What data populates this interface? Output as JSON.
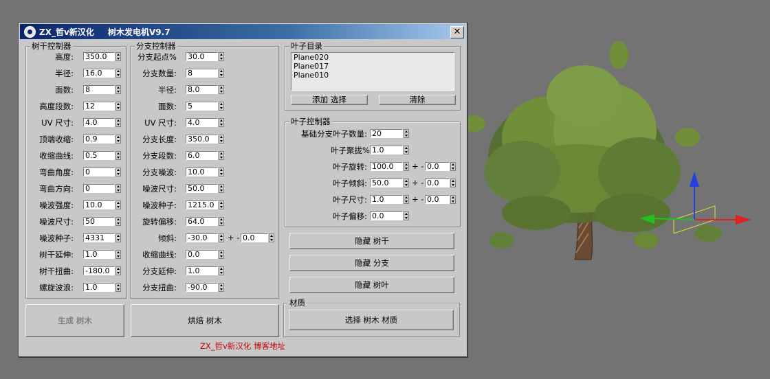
{
  "window": {
    "title_left": "ZX_哲v新汉化",
    "title_right": "树木发电机V9.7",
    "close_glyph": "✕"
  },
  "trunk": {
    "title": "树干控制器",
    "rows": [
      {
        "label": "高度:",
        "value": "350.0"
      },
      {
        "label": "半径:",
        "value": "16.0"
      },
      {
        "label": "面数:",
        "value": "8"
      },
      {
        "label": "高度段数:",
        "value": "12"
      },
      {
        "label": "UV 尺寸:",
        "value": "4.0"
      },
      {
        "label": "顶端收缩:",
        "value": "0.9"
      },
      {
        "label": "收缩曲线:",
        "value": "0.5"
      },
      {
        "label": "弯曲角度:",
        "value": "0"
      },
      {
        "label": "弯曲方向:",
        "value": "0"
      },
      {
        "label": "噪波强度:",
        "value": "10.0"
      },
      {
        "label": "噪波尺寸:",
        "value": "50"
      },
      {
        "label": "噪波种子:",
        "value": "4331"
      },
      {
        "label": "树干延伸:",
        "value": "1.0"
      },
      {
        "label": "树干扭曲:",
        "value": "-180.0"
      },
      {
        "label": "螺旋波浪:",
        "value": "1.0"
      }
    ]
  },
  "branch": {
    "title": "分支控制器",
    "rows": [
      {
        "label": "分支起点%",
        "value": "30.0"
      },
      {
        "label": "分支数量:",
        "value": "8"
      },
      {
        "label": "半径:",
        "value": "8.0"
      },
      {
        "label": "面数:",
        "value": "5"
      },
      {
        "label": "UV 尺寸:",
        "value": "4.0"
      },
      {
        "label": "分支长度:",
        "value": "350.0"
      },
      {
        "label": "分支段数:",
        "value": "6.0"
      },
      {
        "label": "分支噪波:",
        "value": "10.0"
      },
      {
        "label": "噪波尺寸:",
        "value": "50.0"
      },
      {
        "label": "噪波种子:",
        "value": "1215.0"
      },
      {
        "label": "旋转偏移:",
        "value": "64.0"
      },
      {
        "label": "倾斜:",
        "value": "-30.0"
      },
      {
        "label": "收缩曲线:",
        "value": "0.0"
      },
      {
        "label": "分支延伸:",
        "value": "1.0"
      },
      {
        "label": "分支扭曲:",
        "value": "-90.0"
      }
    ],
    "tilt_plusminus": "+ -",
    "tilt_variance": "0.0"
  },
  "leaf_list": {
    "title": "叶子目录",
    "items": [
      "Plane020",
      "Plane017",
      "Plane010"
    ],
    "add_label": "添加 选择",
    "clear_label": "清除"
  },
  "leaf_ctrl": {
    "title": "叶子控制器",
    "base_label": "基础分支叶子数量:",
    "base_value": "20",
    "cluster_label": "叶子聚拢%",
    "cluster_value": "1.0",
    "rotate_label": "叶子旋转:",
    "rotate_value": "100.0",
    "rotate_var": "0.0",
    "tilt_label": "叶子倾斜:",
    "tilt_value": "50.0",
    "tilt_var": "0.0",
    "size_label": "叶子尺寸:",
    "size_value": "1.0",
    "size_var": "0.0",
    "offset_label": "叶子偏移:",
    "offset_value": "0.0",
    "plusminus": "+ -"
  },
  "hide": {
    "trunk": "隐藏 树干",
    "branch": "隐藏 分支",
    "leaf": "隐藏 树叶"
  },
  "material": {
    "title": "材质",
    "select_label": "选择 树木 材质"
  },
  "actions": {
    "generate": "生成 树木",
    "bake": "烘焙 树木"
  },
  "footer": {
    "link": "ZX_哲v新汉化 博客地址"
  },
  "colors": {
    "viewport_bg": "#737373",
    "dialog_bg": "#c8c8c8",
    "title_bar": "#0a246a",
    "leaf_green": "#6f8f3a",
    "trunk_brown": "#6a4a32",
    "axis_x": "#e02020",
    "axis_y": "#20c020",
    "axis_z": "#2040e0",
    "footer_link": "#c00000"
  }
}
